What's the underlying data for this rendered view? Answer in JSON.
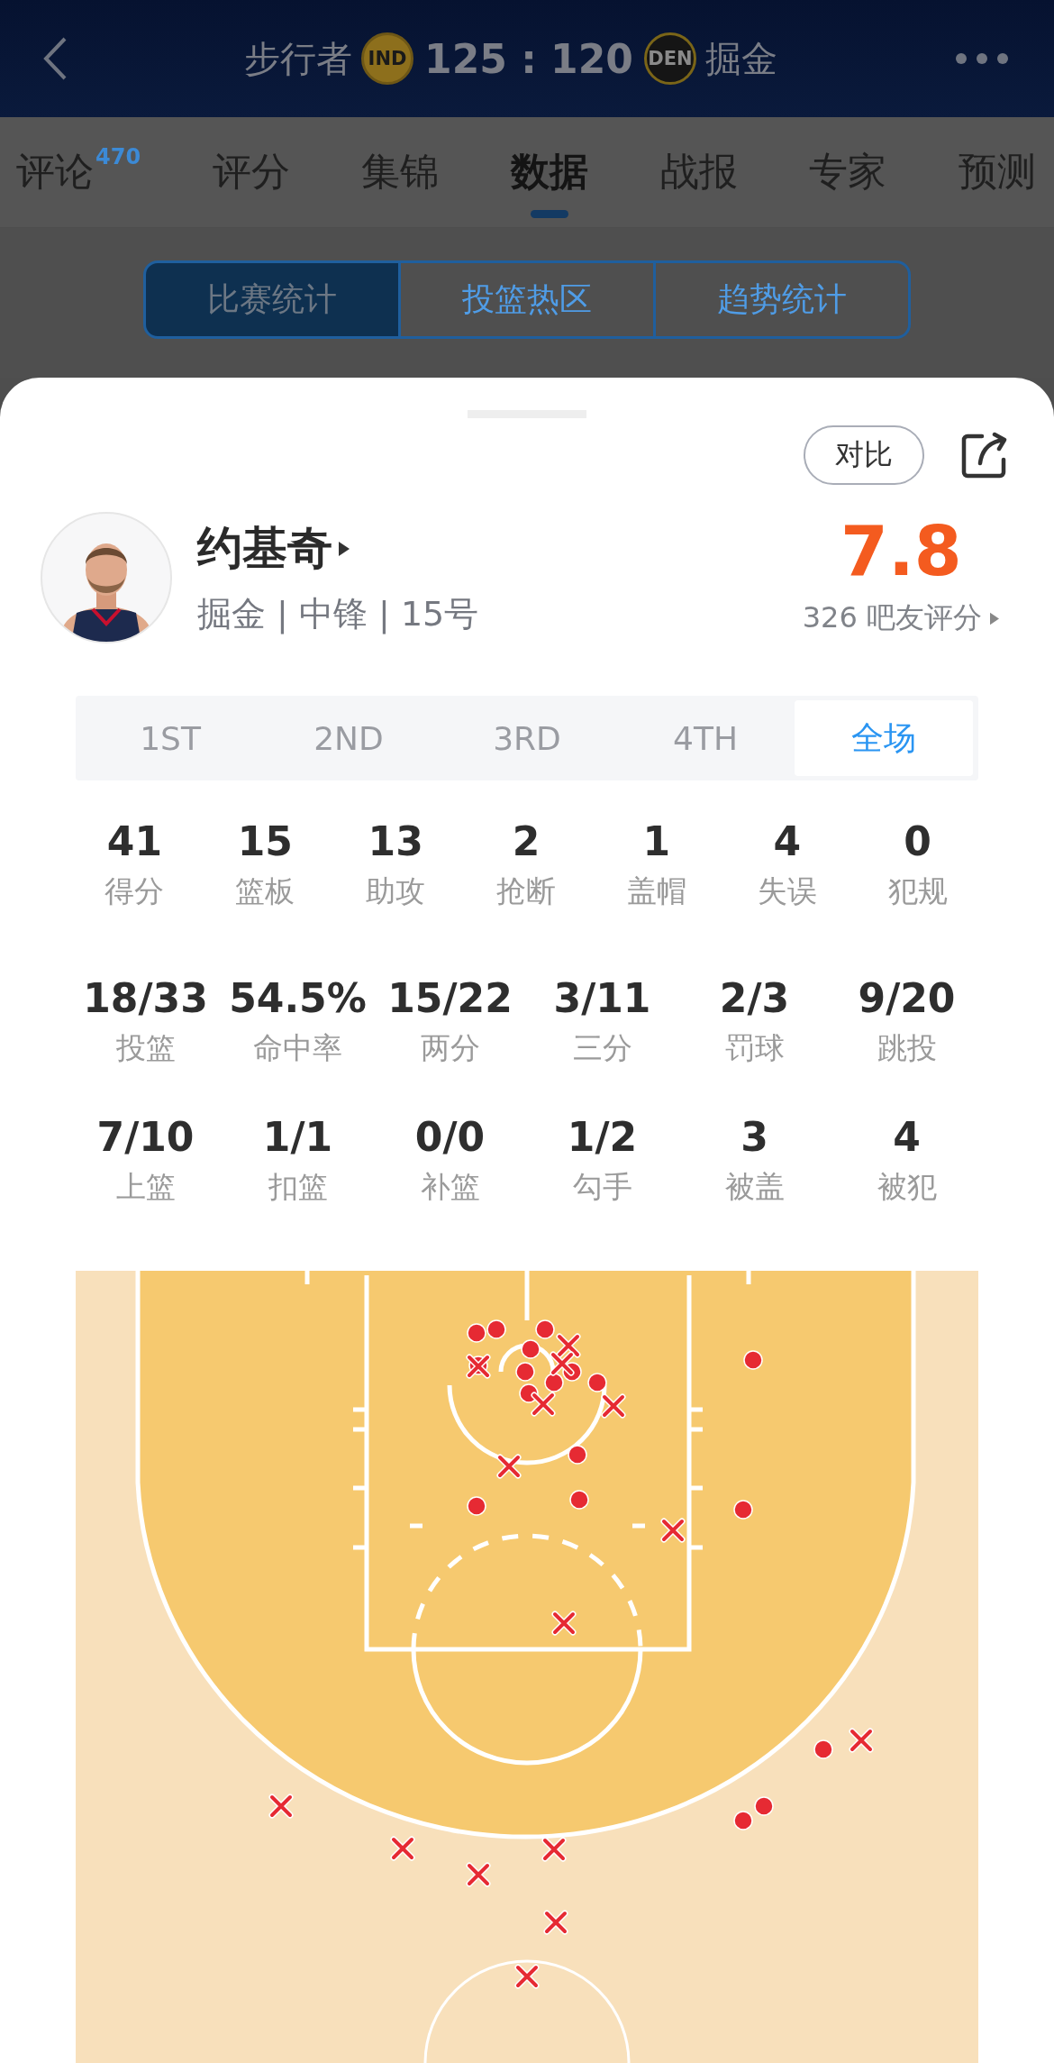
{
  "header": {
    "home_team": "步行者",
    "home_logo": "IND",
    "score": "125 : 120",
    "away_logo": "DEN",
    "away_team": "掘金"
  },
  "tabs": [
    {
      "label": "评论",
      "badge": "470",
      "selected": false
    },
    {
      "label": "评分",
      "selected": false
    },
    {
      "label": "集锦",
      "selected": false
    },
    {
      "label": "数据",
      "selected": true
    },
    {
      "label": "战报",
      "selected": false
    },
    {
      "label": "专家",
      "selected": false
    },
    {
      "label": "预测",
      "selected": false
    }
  ],
  "segments": [
    {
      "label": "比赛统计",
      "selected": true
    },
    {
      "label": "投篮热区",
      "selected": false
    },
    {
      "label": "趋势统计",
      "selected": false
    }
  ],
  "sheet": {
    "compare_button": "对比",
    "player": {
      "name": "约基奇",
      "info": "掘金 | 中锋 | 15号",
      "rating": "7.8",
      "rating_count": "326 吧友评分"
    },
    "periods": [
      {
        "label": "1ST",
        "selected": false
      },
      {
        "label": "2ND",
        "selected": false
      },
      {
        "label": "3RD",
        "selected": false
      },
      {
        "label": "4TH",
        "selected": false
      },
      {
        "label": "全场",
        "selected": true
      }
    ],
    "stat_rows": [
      [
        {
          "value": "41",
          "label": "得分"
        },
        {
          "value": "15",
          "label": "篮板"
        },
        {
          "value": "13",
          "label": "助攻"
        },
        {
          "value": "2",
          "label": "抢断"
        },
        {
          "value": "1",
          "label": "盖帽"
        },
        {
          "value": "4",
          "label": "失误"
        },
        {
          "value": "0",
          "label": "犯规"
        }
      ],
      [
        {
          "value": "18/33",
          "label": "投篮"
        },
        {
          "value": "54.5%",
          "label": "命中率"
        },
        {
          "value": "15/22",
          "label": "两分"
        },
        {
          "value": "3/11",
          "label": "三分"
        },
        {
          "value": "2/3",
          "label": "罚球"
        },
        {
          "value": "9/20",
          "label": "跳投"
        }
      ],
      [
        {
          "value": "7/10",
          "label": "上篮"
        },
        {
          "value": "1/1",
          "label": "扣篮"
        },
        {
          "value": "0/0",
          "label": "补篮"
        },
        {
          "value": "1/2",
          "label": "勾手"
        },
        {
          "value": "3",
          "label": "被盖"
        },
        {
          "value": "4",
          "label": "被犯"
        }
      ]
    ],
    "shot_chart": {
      "shots": [
        {
          "made": true
        },
        {
          "made": true
        },
        {
          "made": true
        },
        {
          "made": true
        },
        {
          "made": true
        },
        {
          "made": true
        },
        {
          "made": true
        },
        {
          "made": true
        },
        {
          "made": true
        },
        {
          "made": true
        },
        {
          "made": true
        },
        {
          "made": true
        },
        {
          "made": true
        },
        {
          "made": true
        },
        {
          "made": true
        },
        {
          "made": true
        },
        {
          "made": true
        },
        {
          "made": true
        },
        {
          "made": false
        },
        {
          "made": false
        },
        {
          "made": false
        },
        {
          "made": false
        },
        {
          "made": false
        },
        {
          "made": false
        },
        {
          "made": false
        },
        {
          "made": false
        },
        {
          "made": false
        },
        {
          "made": false
        },
        {
          "made": false
        },
        {
          "made": false
        },
        {
          "made": false
        },
        {
          "made": false
        },
        {
          "made": false
        }
      ]
    }
  }
}
